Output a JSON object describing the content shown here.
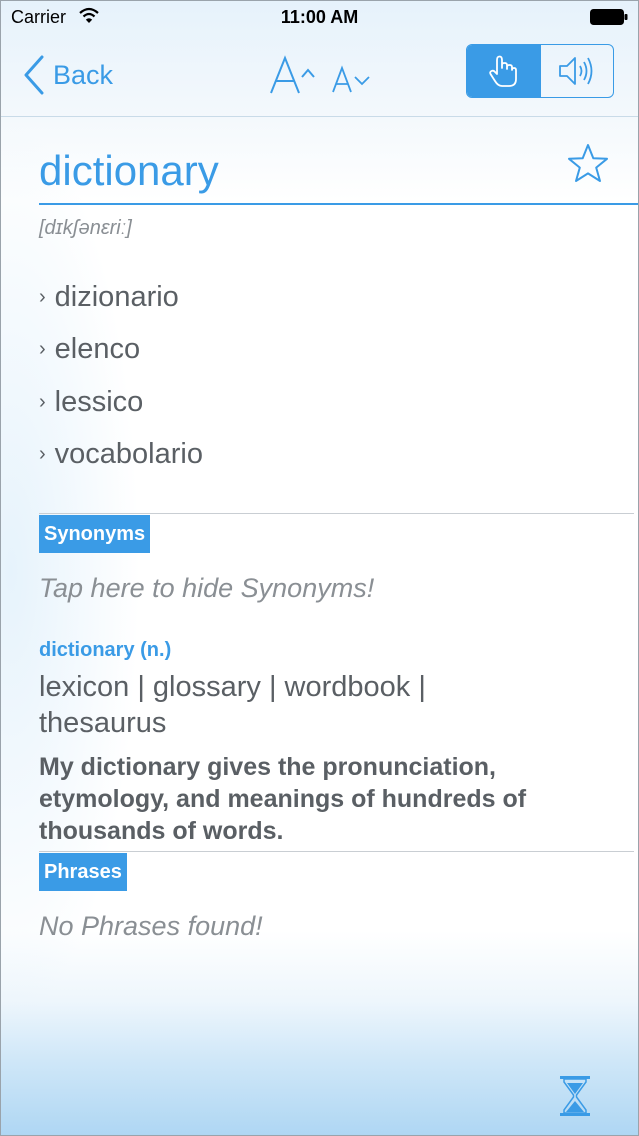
{
  "status_bar": {
    "carrier": "Carrier",
    "time": "11:00 AM"
  },
  "nav": {
    "back_label": "Back",
    "font_up_label": "A",
    "font_down_label": "A",
    "modes": [
      "touch",
      "speaker"
    ]
  },
  "entry": {
    "word": "dictionary",
    "pronunciation": "[dɪkʃənɛriː]",
    "translations": [
      {
        "label": "dizionario"
      },
      {
        "label": "elenco"
      },
      {
        "label": "lessico"
      },
      {
        "label": "vocabolario"
      }
    ]
  },
  "synonyms": {
    "tag": "Synonyms",
    "hint": "Tap here to hide Synonyms!",
    "head": "dictionary (n.)",
    "list": "lexicon | glossary | wordbook | thesaurus",
    "example": "My dictionary gives the pronunciation, etymology, and meanings of hundreds of thousands of words."
  },
  "phrases": {
    "tag": "Phrases",
    "empty": "No Phrases found!"
  },
  "colors": {
    "accent": "#3a9be6",
    "text": "#5a5f64",
    "muted": "#8a8f94"
  }
}
